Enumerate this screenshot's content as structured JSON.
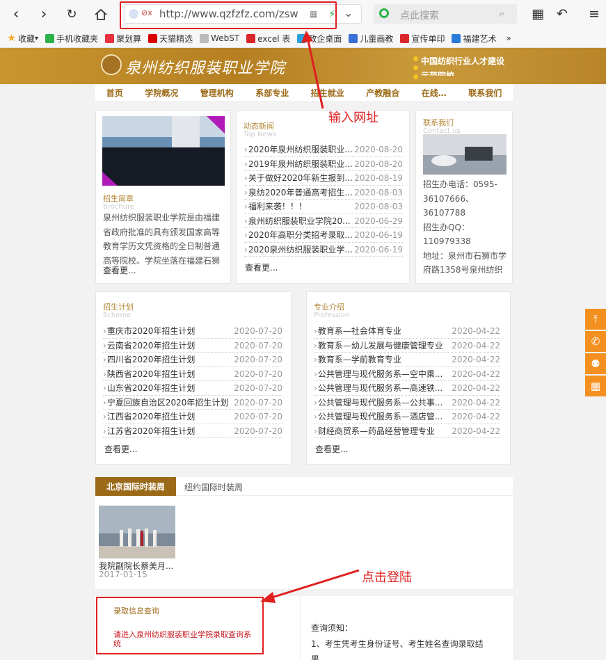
{
  "browser": {
    "url": "http://www.qzfzfz.com/zsw",
    "search_placeholder": "点此搜索"
  },
  "bookmarks": [
    {
      "label": "收藏",
      "icon": "star-icon",
      "color": "#f5a623"
    },
    {
      "label": "手机收藏夹",
      "icon": "phone-icon",
      "color": "#2bb24c"
    },
    {
      "label": "聚划算",
      "icon": "jhs-icon",
      "color": "#e8303f"
    },
    {
      "label": "天猫精选",
      "icon": "tmall-icon",
      "color": "#d90000"
    },
    {
      "label": "WebST",
      "icon": "page-icon",
      "color": "#bbbbbb"
    },
    {
      "label": "excel 表",
      "icon": "c-icon",
      "color": "#d8262b"
    },
    {
      "label": "政企桌面",
      "icon": "globe-icon",
      "color": "#2aa0d8"
    },
    {
      "label": "儿童画教",
      "icon": "kid-icon",
      "color": "#3b6fd4"
    },
    {
      "label": "宣传单印",
      "icon": "print-icon",
      "color": "#d8262b"
    },
    {
      "label": "福建艺术",
      "icon": "paw-icon",
      "color": "#2a7ad8"
    }
  ],
  "site": {
    "name": "泉州纺织服装职业学院",
    "slogan_1": "中国纺织行业人才建设",
    "slogan_2": "示范院校"
  },
  "nav": [
    "首页",
    "学院概况",
    "管理机构",
    "系部专业",
    "招生就业",
    "产教融合",
    "在线…",
    "联系我们"
  ],
  "brochure": {
    "title": "招生简章",
    "subtitle": "Brochure",
    "text": "泉州纺织服装职业学院是由福建省政府批准的具有颁发国家高等教育学历文凭资格的全日制普通高等院校。学院坐落在福建石狮",
    "more": "查看更..."
  },
  "news": {
    "title": "动态新闻",
    "subtitle": "Top News",
    "items": [
      {
        "t": "2020年泉州纺织服装职业...",
        "d": "2020-08-20"
      },
      {
        "t": "2019年泉州纺织服装职业...",
        "d": "2020-08-20"
      },
      {
        "t": "关于做好2020年新生报到...",
        "d": "2020-08-19"
      },
      {
        "t": "泉纺2020年普通高考招生...",
        "d": "2020-08-03"
      },
      {
        "t": "福利来袭！！！",
        "d": "2020-08-03"
      },
      {
        "t": "泉州纺织服装职业学院20...",
        "d": "2020-06-29"
      },
      {
        "t": "2020年高职分类招考录取...",
        "d": "2020-06-19"
      },
      {
        "t": "2020泉州纺织服装职业学...",
        "d": "2020-06-19"
      }
    ],
    "more": "查看更..."
  },
  "contact": {
    "title": "联系我们",
    "subtitle": "Contact us",
    "lines": [
      "招生办电话：0595-",
      "36107666、",
      "36107788",
      "招生办QQ：",
      "110979338",
      "地址：泉州市石狮市学",
      "府路1358号泉州纺织"
    ]
  },
  "scheme": {
    "title": "招生计划",
    "subtitle": "Scheme",
    "items": [
      {
        "t": "重庆市2020年招生计划",
        "d": "2020-07-20"
      },
      {
        "t": "云南省2020年招生计划",
        "d": "2020-07-20"
      },
      {
        "t": "四川省2020年招生计划",
        "d": "2020-07-20"
      },
      {
        "t": "陕西省2020年招生计划",
        "d": "2020-07-20"
      },
      {
        "t": "山东省2020年招生计划",
        "d": "2020-07-20"
      },
      {
        "t": "宁夏回族自治区2020年招生计划",
        "d": "2020-07-20"
      },
      {
        "t": "江西省2020年招生计划",
        "d": "2020-07-20"
      },
      {
        "t": "江苏省2020年招生计划",
        "d": "2020-07-20"
      }
    ],
    "more": "查看更..."
  },
  "profession": {
    "title": "专业介绍",
    "subtitle": "Profession",
    "items": [
      {
        "t": "教育系—社会体育专业",
        "d": "2020-04-22"
      },
      {
        "t": "教育系—幼儿发展与健康管理专业",
        "d": "2020-04-22"
      },
      {
        "t": "教育系—学前教育专业",
        "d": "2020-04-22"
      },
      {
        "t": "公共管理与现代服务系—空中乘...",
        "d": "2020-04-22"
      },
      {
        "t": "公共管理与现代服务系—高速铁...",
        "d": "2020-04-22"
      },
      {
        "t": "公共管理与现代服务系—公共事...",
        "d": "2020-04-22"
      },
      {
        "t": "公共管理与现代服务系—酒店管...",
        "d": "2020-04-22"
      },
      {
        "t": "财经商贸系—药品经营管理专业",
        "d": "2020-04-22"
      }
    ],
    "more": "查看更..."
  },
  "fashion": {
    "tab_active": "北京国际时装周",
    "tab_inactive": "纽约国际时装周",
    "caption": "我院副院长蔡美月...",
    "date": "2017-01-15"
  },
  "admission": {
    "title": "录取信息查询",
    "link": "请进入泉州纺织服装职业学院录取查询系统",
    "notice_title": "查询须知：",
    "notice_1": "1、考生凭考生身份证号、考生姓名查询录取结",
    "notice_2": "果"
  },
  "annotations": {
    "enter_url": "输入网址",
    "click_login": "点击登陆",
    "color": "#e02020"
  }
}
